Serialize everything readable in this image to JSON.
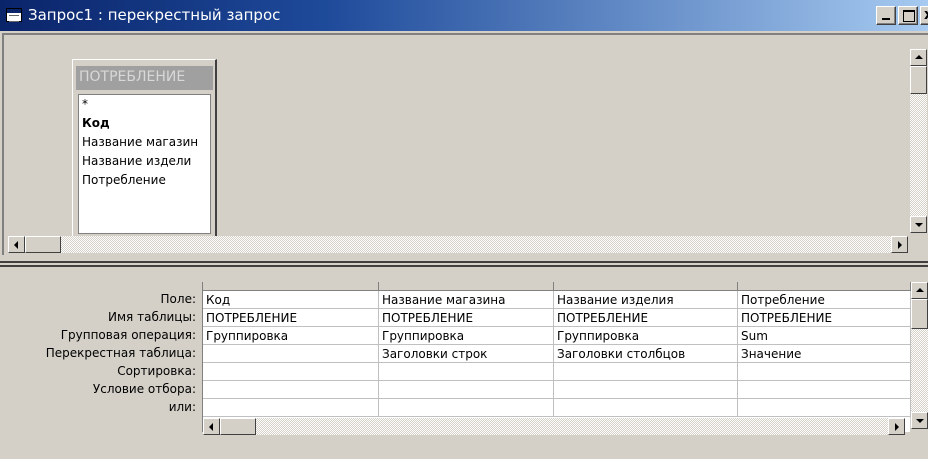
{
  "window": {
    "title": "Запрос1 : перекрестный запрос",
    "close_glyph": "x",
    "title_gradient_start": "#0a246a",
    "title_gradient_end": "#a6caf0"
  },
  "table": {
    "name": "ПОТРЕБЛЕНИЕ",
    "fields": [
      {
        "label": "*",
        "bold": false
      },
      {
        "label": "Код",
        "bold": true
      },
      {
        "label": "Название магазин",
        "bold": false
      },
      {
        "label": "Название издели",
        "bold": false
      },
      {
        "label": "Потребление",
        "bold": false
      }
    ]
  },
  "grid": {
    "row_labels": [
      "Поле:",
      "Имя таблицы:",
      "Групповая операция:",
      "Перекрестная таблица:",
      "Сортировка:",
      "Условие отбора:",
      "или:"
    ],
    "columns": [
      {
        "field": "Код",
        "table": "ПОТРЕБЛЕНИЕ",
        "group": "Группировка",
        "crosstab": "",
        "sort": "",
        "criteria": "",
        "or": ""
      },
      {
        "field": "Название магазина",
        "table": "ПОТРЕБЛЕНИЕ",
        "group": "Группировка",
        "crosstab": "Заголовки строк",
        "sort": "",
        "criteria": "",
        "or": ""
      },
      {
        "field": "Название изделия",
        "table": "ПОТРЕБЛЕНИЕ",
        "group": "Группировка",
        "crosstab": "Заголовки столбцов",
        "sort": "",
        "criteria": "",
        "or": ""
      },
      {
        "field": "Потребление",
        "table": "ПОТРЕБЛЕНИЕ",
        "group": "Sum",
        "crosstab": "Значение",
        "sort": "",
        "criteria": "",
        "or": ""
      }
    ]
  }
}
